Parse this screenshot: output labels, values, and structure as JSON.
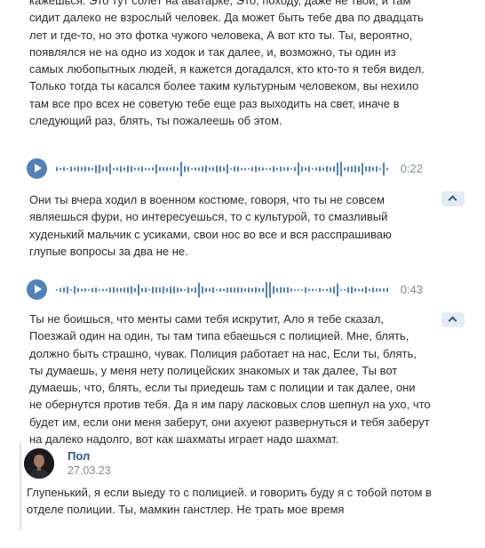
{
  "messages": {
    "transcript_1": "кажешься. Это тут солёт на аватарке, Это, походу, даже не твой, и там сидит далеко не взрослый человек. Да может быть тебе два по двадцать лет и где-то, но это фотка чужого человека, А вот кто ты. Ты, вероятно, появлялся не на одно из ходок и так далее, и, возможно, ты один из самых любопытных людей, я кажется догадался, кто кто-то я тебя видел. Только тогда ты касался более таким культурным человеком, вы нехило там все про всех не советую тебе еще раз выходить на свет, иначе в следующий раз, блять, ты пожалеешь об этом.",
    "audio_1_duration": "0:22",
    "transcript_2": "Они ты вчера ходил в военном костюме, говоря, что ты не совсем являешься фури, но интересуешься, то с культурой, то смазливый худенький мальчик с усиками, свои нос во все и вся расспрашиваю глупые вопросы за два не не.",
    "audio_2_duration": "0:43",
    "transcript_3": "Ты не боишься, что менты сами тебя искрутит, Ало я тебе сказал, Поезжай один на один, ты там типа ебаешься с полицией. Мне, блять, должно быть страшно, чувак. Полиция работает на нас, Если ты, блять, ты думаешь, у меня нету полицейских знакомых и так далее, Ты вот думаешь, что, блять, если ты приедешь там с полиции и так далее, они не обернутся против тебя. Да я им пару ласковых слов шепнул на ухо, что будет им, если они меня заберут, они ахуеют развернуться и тебя заберут на далеко надолго, вот как шахматы играет надо шахмат."
  },
  "reply": {
    "author": "Пол",
    "date": "27.03.23",
    "text": "Глупенький, я если выеду то с полицией. и говорить буду я с тобой потом в отделе полиции. Ты, мамкин ганстлер. Не трать мое время"
  },
  "colors": {
    "accent": "#5181b8",
    "link": "#2a5885",
    "secondary_text": "#818c99",
    "collapse_bg": "#e3ecf6"
  },
  "icons": {
    "play": "play-icon",
    "collapse": "chevron-up-icon"
  }
}
